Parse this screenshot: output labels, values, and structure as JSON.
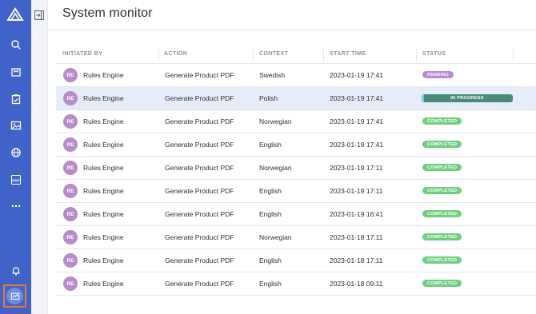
{
  "page": {
    "title": "System monitor"
  },
  "sidebar": {
    "items": [
      {
        "icon": "logo-icon"
      },
      {
        "icon": "search-icon"
      },
      {
        "icon": "package-icon"
      },
      {
        "icon": "clipboard-check-icon"
      },
      {
        "icon": "image-icon"
      },
      {
        "icon": "globe-icon"
      },
      {
        "icon": "pdf-icon",
        "label": "PDF"
      },
      {
        "icon": "more-icon"
      },
      {
        "icon": "bell-icon"
      },
      {
        "icon": "system-monitor-icon",
        "active": true
      }
    ],
    "accent": "#3f63c9",
    "active_outline": "#e8782e"
  },
  "table": {
    "columns": [
      "INITIATED BY",
      "ACTION",
      "CONTEXT",
      "START TIME",
      "STATUS"
    ],
    "rows": [
      {
        "initials": "RE",
        "initiated_by": "Rules Engine",
        "action": "Generate Product PDF",
        "context": "Swedish",
        "start_time": "2023-01-19 17:41",
        "status": "PENDING"
      },
      {
        "initials": "RE",
        "initiated_by": "Rules Engine",
        "action": "Generate Product PDF",
        "context": "Polish",
        "start_time": "2023-01-19 17:41",
        "status": "IN PROGRESS",
        "progress": 0.03
      },
      {
        "initials": "RE",
        "initiated_by": "Rules Engine",
        "action": "Generate Product PDF",
        "context": "Norwegian",
        "start_time": "2023-01-19 17:41",
        "status": "COMPLETED"
      },
      {
        "initials": "RE",
        "initiated_by": "Rules Engine",
        "action": "Generate Product PDF",
        "context": "English",
        "start_time": "2023-01-19 17:41",
        "status": "COMPLETED"
      },
      {
        "initials": "RE",
        "initiated_by": "Rules Engine",
        "action": "Generate Product PDF",
        "context": "Norwegian",
        "start_time": "2023-01-19 17:11",
        "status": "COMPLETED"
      },
      {
        "initials": "RE",
        "initiated_by": "Rules Engine",
        "action": "Generate Product PDF",
        "context": "English",
        "start_time": "2023-01-19 17:11",
        "status": "COMPLETED"
      },
      {
        "initials": "RE",
        "initiated_by": "Rules Engine",
        "action": "Generate Product PDF",
        "context": "English",
        "start_time": "2023-01-19 16:41",
        "status": "COMPLETED"
      },
      {
        "initials": "RE",
        "initiated_by": "Rules Engine",
        "action": "Generate Product PDF",
        "context": "Norwegian",
        "start_time": "2023-01-18 17:11",
        "status": "COMPLETED"
      },
      {
        "initials": "RE",
        "initiated_by": "Rules Engine",
        "action": "Generate Product PDF",
        "context": "English",
        "start_time": "2023-01-18 17:11",
        "status": "COMPLETED"
      },
      {
        "initials": "RE",
        "initiated_by": "Rules Engine",
        "action": "Generate Product PDF",
        "context": "English",
        "start_time": "2023-01-18 09:11",
        "status": "COMPLETED"
      }
    ],
    "selected_row": 1
  },
  "status_colors": {
    "PENDING": "#b98ad0",
    "COMPLETED": "#6fcf7e",
    "IN PROGRESS": "#4b8b7a"
  },
  "avatar_color": "#b88ccb"
}
